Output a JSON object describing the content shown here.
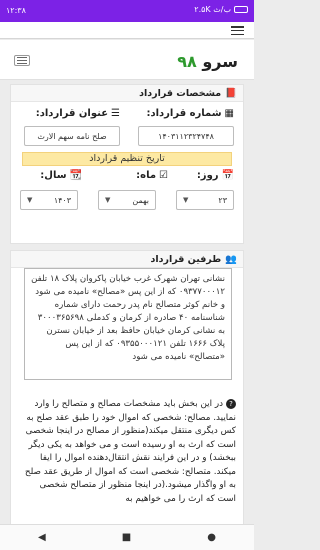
{
  "status": {
    "time": "۱۲:۳۸",
    "network": "۲.۵K ب/ث",
    "icons": [
      "battery-icon",
      "signal-icon",
      "wifi-icon",
      "dots-icon",
      "sim-icon"
    ]
  },
  "brand": {
    "logo_text": "سرو",
    "logo_num": "۹۸"
  },
  "contract": {
    "section_title": "مشخصات قرارداد",
    "number_label": "شماره قرارداد:",
    "number_value": "۱۴۰۳۱۱۲۳۲۴۷۴۸",
    "title_label": "عنوان قرارداد:",
    "title_value": "صلح نامه سهم الارث",
    "date_banner": "تاریخ تنظیم قرارداد",
    "day_label": "روز:",
    "day_value": "۲۳",
    "month_label": "ماه:",
    "month_value": "بهمن",
    "year_label": "سال:",
    "year_value": "۱۴۰۳"
  },
  "parties": {
    "section_title": "طرفین قرارداد",
    "text": "نشانی تهران شهرک غرب خیابان پاکروان پلاک ۱۸ تلفن ۰۹۳۷۷۰۰۰۱۲ که از این پس «مصالح» نامیده می شود و خانم کوثر متصالح نام پدر رحمت دارای شماره شناسنامه ۴۰ صادره از کرمان و کدملی ۳۰۰۰۳۶۵۶۹۸ به نشانی کرمان خیابان حافظ بعد از خیابان نسترن پلاک ۱۶۶۶ تلفن ۰۹۳۵۵۰۰۰۱۲۱ که از این پس «متصالح» نامیده می شود"
  },
  "notes": {
    "text": "در این بخش باید مشخصات مصالح و متصالح را وارد نمایید. مصالح: شخصی که اموال خود را طبق عقد صلح به کس دیگری منتقل میکند(منظور از مصالح در اینجا شخصی است که ارث به او رسیده است و می خواهد به یکی دیگر ببخشد) و در این فرایند نقش انتقال‌دهنده اموال را ایفا میکند. متصالح: شخصی است که اموال از طریق عقد صلح به او واگذار میشود.(در اینجا منظور از متصالح شخصی است که ارث را می خواهیم به"
  },
  "nav": {
    "back": "◀",
    "home": "■",
    "recent": "●"
  }
}
